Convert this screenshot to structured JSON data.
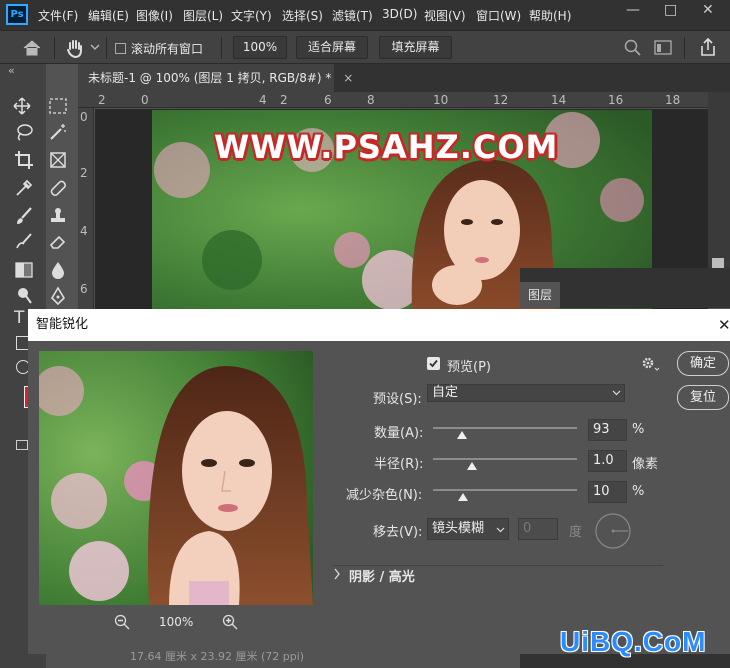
{
  "app": {
    "logo_text": "Ps"
  },
  "menu": [
    "文件(F)",
    "编辑(E)",
    "图像(I)",
    "图层(L)",
    "文字(Y)",
    "选择(S)",
    "滤镜(T)",
    "3D(D)",
    "视图(V)",
    "窗口(W)",
    "帮助(H)"
  ],
  "window_controls": {
    "minimize": "—",
    "restore": "□",
    "close": "✕"
  },
  "options_bar": {
    "scroll_all_label": "滚动所有窗口",
    "zoom_value": "100%",
    "fit_screen": "适合屏幕",
    "fill_screen": "填充屏幕"
  },
  "document_tab": {
    "title": "未标题-1 @ 100% (图层 1 拷贝, RGB/8#) *",
    "close": "×"
  },
  "collapse_glyph": "«",
  "ruler_top": [
    "2",
    "0",
    "2",
    "4",
    "6",
    "8",
    "10",
    "12",
    "14",
    "16",
    "18"
  ],
  "ruler_left": [
    "0",
    "2",
    "4",
    "6"
  ],
  "canvas_watermark": "WWW.PSAHZ.COM",
  "layers_panel": {
    "tab": "图层"
  },
  "dialog": {
    "title": "智能锐化",
    "close": "✕",
    "preview_label": "预览(P)",
    "preview_checked": true,
    "preset_label": "预设(S):",
    "preset_value": "自定",
    "amount_label": "数量(A):",
    "amount_value": "93",
    "amount_unit": "%",
    "amount_fraction": 0.093,
    "radius_label": "半径(R):",
    "radius_value": "1.0",
    "radius_unit": "像素",
    "radius_fraction": 0.16,
    "noise_label": "减少杂色(N):",
    "noise_value": "10",
    "noise_unit": "%",
    "noise_fraction": 0.1,
    "remove_label": "移去(V):",
    "remove_value": "镜头模糊",
    "angle_value": "0",
    "angle_unit": "度",
    "shadows_label": "阴影 / 高光",
    "ok_button": "确定",
    "reset_button": "复位",
    "zoom_value": "100%"
  },
  "status_bar": {
    "text": "17.64 厘米 x 23.92 厘米 (72 ppi)"
  },
  "site_logo": "UiBQ.CoM",
  "colors": {
    "accent": "#31a8ff",
    "watermark_outline": "#c62828",
    "site_logo": "#2a8cff"
  }
}
